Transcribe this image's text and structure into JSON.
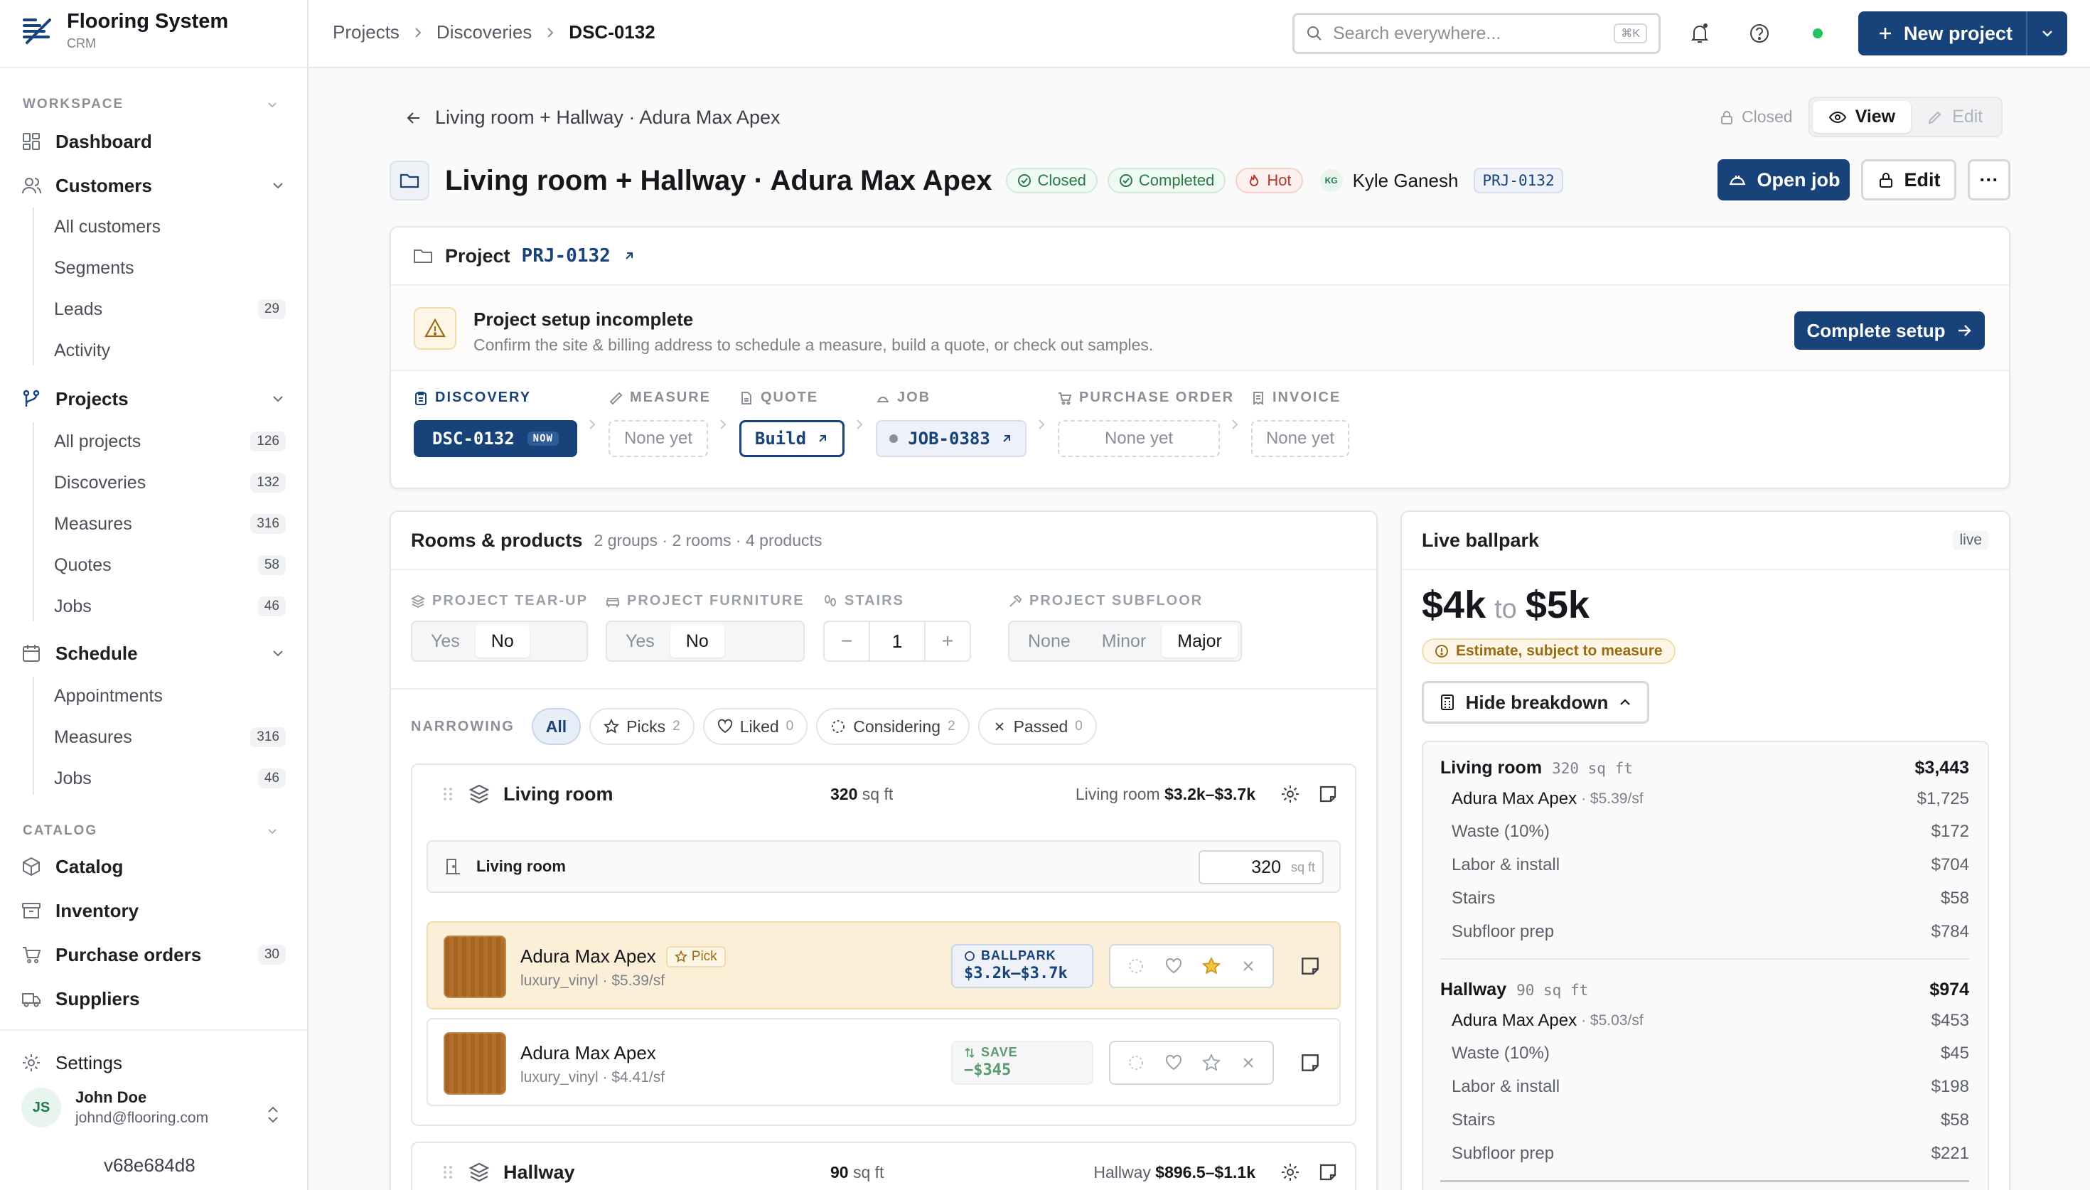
{
  "app": {
    "name": "Flooring System",
    "sub": "CRM",
    "version": "v68e684d8"
  },
  "sidebar": {
    "workspace_label": "WORKSPACE",
    "catalog_label": "CATALOG",
    "dashboard": "Dashboard",
    "customers": {
      "label": "Customers",
      "items": [
        {
          "label": "All customers"
        },
        {
          "label": "Segments"
        },
        {
          "label": "Leads",
          "count": "29"
        },
        {
          "label": "Activity"
        }
      ]
    },
    "projects": {
      "label": "Projects",
      "items": [
        {
          "label": "All projects",
          "count": "126"
        },
        {
          "label": "Discoveries",
          "count": "132"
        },
        {
          "label": "Measures",
          "count": "316"
        },
        {
          "label": "Quotes",
          "count": "58"
        },
        {
          "label": "Jobs",
          "count": "46"
        }
      ]
    },
    "schedule": {
      "label": "Schedule",
      "items": [
        {
          "label": "Appointments"
        },
        {
          "label": "Measures",
          "count": "316"
        },
        {
          "label": "Jobs",
          "count": "46"
        }
      ]
    },
    "catalog": [
      {
        "label": "Catalog"
      },
      {
        "label": "Inventory"
      },
      {
        "label": "Purchase orders",
        "count": "30"
      },
      {
        "label": "Suppliers"
      }
    ],
    "settings": "Settings",
    "user": {
      "initials": "JS",
      "name": "John Doe",
      "email": "johnd@flooring.com"
    }
  },
  "topbar": {
    "breadcrumbs": [
      "Projects",
      "Discoveries",
      "DSC-0132"
    ],
    "search_placeholder": "Search everywhere...",
    "search_shortcut": "⌘K",
    "new_project": "New project"
  },
  "header": {
    "back_label": "Living room + Hallway · Adura Max Apex",
    "mode_closed": "Closed",
    "mode_view": "View",
    "mode_edit": "Edit",
    "title": "Living room + Hallway · Adura Max Apex",
    "status_closed": "Closed",
    "status_completed": "Completed",
    "status_hot": "Hot",
    "owner_initials": "KG",
    "owner": "Kyle Ganesh",
    "project_code": "PRJ-0132",
    "open_job": "Open job",
    "edit": "Edit",
    "more": "···"
  },
  "project_card": {
    "label": "Project",
    "code": "PRJ-0132",
    "setup_title": "Project setup incomplete",
    "setup_desc": "Confirm the site & billing address to schedule a measure, build a quote, or check out samples.",
    "setup_button": "Complete setup",
    "stages": [
      {
        "label": "DISCOVERY",
        "value": "DSC-0132",
        "badge": "NOW"
      },
      {
        "label": "MEASURE",
        "value": "None yet"
      },
      {
        "label": "QUOTE",
        "value": "Build"
      },
      {
        "label": "JOB",
        "value": "JOB-0383"
      },
      {
        "label": "PURCHASE ORDER",
        "value": "None yet"
      },
      {
        "label": "INVOICE",
        "value": "None yet"
      }
    ]
  },
  "rooms": {
    "title": "Rooms & products",
    "summary": "2 groups · 2 rooms · 4 products",
    "tearup": {
      "label": "PROJECT TEAR-UP",
      "options": [
        "Yes",
        "No"
      ],
      "selected": "No"
    },
    "furniture": {
      "label": "PROJECT FURNITURE",
      "options": [
        "Yes",
        "No"
      ],
      "selected": "No"
    },
    "stairs": {
      "label": "STAIRS",
      "value": "1"
    },
    "subfloor": {
      "label": "PROJECT SUBFLOOR",
      "options": [
        "None",
        "Minor",
        "Major"
      ],
      "selected": "Major"
    },
    "narrowing": {
      "label": "NARROWING",
      "all": "All",
      "picks": "Picks",
      "picks_count": "2",
      "liked": "Liked",
      "liked_count": "0",
      "considering": "Considering",
      "considering_count": "2",
      "passed": "Passed",
      "passed_count": "0"
    },
    "groups": [
      {
        "name": "Living room",
        "sqft": "320",
        "sqft_unit": "sq ft",
        "range_label": "Living room",
        "range": "$3.2k–$3.7k",
        "room": {
          "name": "Living room",
          "sqft": "320",
          "unit": "sq ft"
        },
        "products": [
          {
            "name": "Adura Max Apex",
            "pick": "Pick",
            "sub": "luxury_vinyl · $5.39/sf",
            "tag": "BALLPARK",
            "tag_value": "$3.2k–$3.7k"
          },
          {
            "name": "Adura Max Apex",
            "sub": "luxury_vinyl · $4.41/sf",
            "tag": "SAVE",
            "tag_value": "−$345"
          }
        ]
      },
      {
        "name": "Hallway",
        "sqft": "90",
        "sqft_unit": "sq ft",
        "range_label": "Hallway",
        "range": "$896.5–$1.1k"
      }
    ]
  },
  "ballpark": {
    "title": "Live ballpark",
    "live": "live",
    "low": "$4k",
    "to": "to",
    "high": "$5k",
    "estimate_note": "Estimate, subject to measure",
    "hide_breakdown": "Hide breakdown",
    "rooms": [
      {
        "name": "Living room",
        "sqft": "320 sq ft",
        "total": "$3,443",
        "product": "Adura Max Apex",
        "rate": "· $5.39/sf",
        "product_amt": "$1,725",
        "lines": [
          {
            "label": "Waste (10%)",
            "amt": "$172"
          },
          {
            "label": "Labor & install",
            "amt": "$704"
          },
          {
            "label": "Stairs",
            "amt": "$58"
          },
          {
            "label": "Subfloor prep",
            "amt": "$784"
          }
        ]
      },
      {
        "name": "Hallway",
        "sqft": "90 sq ft",
        "total": "$974",
        "product": "Adura Max Apex",
        "rate": "· $5.03/sf",
        "product_amt": "$453",
        "lines": [
          {
            "label": "Waste (10%)",
            "amt": "$45"
          },
          {
            "label": "Labor & install",
            "amt": "$198"
          },
          {
            "label": "Stairs",
            "amt": "$58"
          },
          {
            "label": "Subfloor prep",
            "amt": "$221"
          }
        ]
      }
    ]
  },
  "colors": {
    "brand": "#17427a",
    "accent_green": "#22c55e",
    "pick_bg": "#fcefd8"
  }
}
